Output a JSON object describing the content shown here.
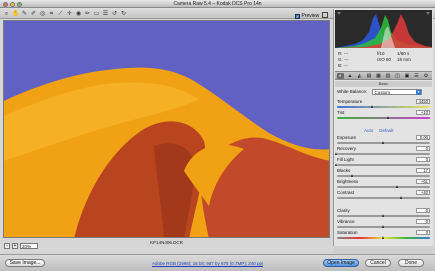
{
  "window": {
    "title": "Camera Raw 5.4  –  Kodak DCS Pro 14n"
  },
  "toolbar": {
    "tools": [
      {
        "name": "zoom-tool-icon",
        "glyph": "⌕"
      },
      {
        "name": "hand-tool-icon",
        "glyph": "✋"
      },
      {
        "name": "white-balance-tool-icon",
        "glyph": "✎"
      },
      {
        "name": "color-sampler-tool-icon",
        "glyph": "✐"
      },
      {
        "name": "targeted-adjustment-tool-icon",
        "glyph": "◎"
      },
      {
        "name": "crop-tool-icon",
        "glyph": "⌗"
      },
      {
        "name": "straighten-tool-icon",
        "glyph": "⟋"
      },
      {
        "name": "spot-removal-tool-icon",
        "glyph": "✛"
      },
      {
        "name": "red-eye-tool-icon",
        "glyph": "◉"
      },
      {
        "name": "adjustment-brush-icon",
        "glyph": "✏"
      },
      {
        "name": "graduated-filter-icon",
        "glyph": "▭"
      },
      {
        "name": "preferences-icon",
        "glyph": "☰"
      },
      {
        "name": "rotate-left-icon",
        "glyph": "↺"
      },
      {
        "name": "rotate-right-icon",
        "glyph": "↻"
      }
    ],
    "preview_label": "Preview",
    "preview_checked": "✓"
  },
  "image": {
    "filename": "KP14N406.DCR"
  },
  "zoom": {
    "minus": "-",
    "plus": "+",
    "value": "20%"
  },
  "camera_info": {
    "r_label": "R:",
    "g_label": "G:",
    "b_label": "B:",
    "r_value": "---",
    "g_value": "---",
    "b_value": "---",
    "aperture": "f/10",
    "shutter": "1/60 s",
    "iso": "ISO 80",
    "focal": "18 mm"
  },
  "panel": {
    "tabs": [
      "◐",
      "▲",
      "◭",
      "▤",
      "▦",
      "▥",
      "◫",
      "▣",
      "☰",
      "⚙"
    ],
    "section_title": "Basic",
    "white_balance_label": "White Balance:",
    "white_balance_value": "Custom",
    "auto_label": "Auto",
    "default_label": "Default",
    "sliders": [
      {
        "label": "Temperature",
        "value": "4450",
        "pos": 0.38,
        "style": "temp"
      },
      {
        "label": "Tint",
        "value": "+10",
        "pos": 0.56,
        "style": "tint"
      },
      {
        "label": "Exposure",
        "value": "0.00",
        "pos": 0.5,
        "style": "gray"
      },
      {
        "label": "Recovery",
        "value": "0",
        "pos": 0.0,
        "style": "gray"
      },
      {
        "label": "Fill Light",
        "value": "0",
        "pos": 0.0,
        "style": "gray"
      },
      {
        "label": "Blacks",
        "value": "17",
        "pos": 0.17,
        "style": "gray"
      },
      {
        "label": "Brightness",
        "value": "+61",
        "pos": 0.65,
        "style": "gray"
      },
      {
        "label": "Contrast",
        "value": "+40",
        "pos": 0.7,
        "style": "gray"
      },
      {
        "label": "Clarity",
        "value": "0",
        "pos": 0.5,
        "style": "gray"
      },
      {
        "label": "Vibrance",
        "value": "0",
        "pos": 0.5,
        "style": "gray"
      },
      {
        "label": "Saturation",
        "value": "0",
        "pos": 0.5,
        "style": "sat"
      }
    ]
  },
  "bottom": {
    "save_label": "Save Image...",
    "workflow_link": "Adobe RGB (1998); 16 bit; 987 by 675 (0.7MP); 240 ppi",
    "open_label": "Open Image",
    "cancel_label": "Cancel",
    "done_label": "Done"
  },
  "colors": {
    "sky": "#6061c2",
    "petal_orange": "#f2a114",
    "petal_red": "#b8451e",
    "accent_blue": "#3a7bd5"
  }
}
